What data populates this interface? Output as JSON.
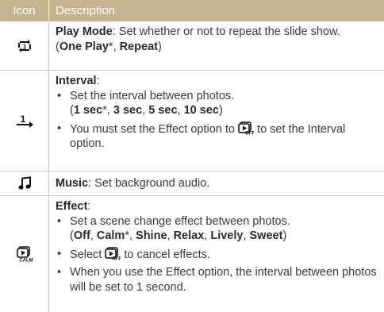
{
  "header": {
    "icon_label": "Icon",
    "description_label": "Description"
  },
  "rows": [
    {
      "icon": "play-mode-repeat-icon",
      "title": "Play Mode",
      "text": ": Set whether or not to repeat the slide show.",
      "options_open": "(",
      "opt1": "One Play",
      "opt1_mark": "*",
      "sep": ", ",
      "opt2": "Repeat",
      "options_close": ")"
    },
    {
      "icon": "interval-icon",
      "title": "Interval",
      "title_suffix": ":",
      "bullet1": "Set the interval between photos.",
      "o_open": "(",
      "o1": "1 sec",
      "o1_mark": "*",
      "o2": "3 sec",
      "o3": "5 sec",
      "o4": "10 sec",
      "o_close": ")",
      "bullet2a": "You must set the Effect option to",
      "bullet2b": "to set the Interval option."
    },
    {
      "icon": "music-note-icon",
      "title": "Music",
      "text": ": Set background audio."
    },
    {
      "icon": "effect-calm-icon",
      "title": "Effect",
      "title_suffix": ":",
      "bullet1": "Set a scene change effect between photos.",
      "o_open": "(",
      "o1": "Off",
      "o2": "Calm",
      "o2_mark": "*",
      "o3": "Shine",
      "o4": "Relax",
      "o5": "Lively",
      "o6": "Sweet",
      "o_close": ")",
      "bullet2a": "Select",
      "bullet2b": "to cancel effects.",
      "bullet3": "When you use the Effect option, the interval between photos will be set to 1 second."
    }
  ],
  "comma": ", ",
  "bullet_char": "•",
  "colors": {
    "header_bg": "#c6b38f",
    "rule": "#c9c9c9",
    "text": "#3a3a3a"
  }
}
